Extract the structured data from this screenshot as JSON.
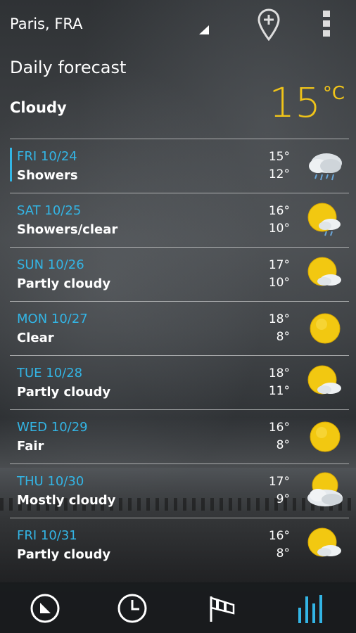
{
  "header": {
    "location": "Paris, FRA"
  },
  "title": "Daily forecast",
  "current": {
    "condition": "Cloudy",
    "temp": "15",
    "unit": "°C"
  },
  "days": [
    {
      "day": "FRI 10/24",
      "desc": "Showers",
      "hi": "15°",
      "lo": "12°",
      "icon": "rain-cloud-icon"
    },
    {
      "day": "SAT 10/25",
      "desc": "Showers/clear",
      "hi": "16°",
      "lo": "10°",
      "icon": "sun-rain-icon"
    },
    {
      "day": "SUN 10/26",
      "desc": "Partly cloudy",
      "hi": "17°",
      "lo": "10°",
      "icon": "partly-cloudy-icon"
    },
    {
      "day": "MON 10/27",
      "desc": "Clear",
      "hi": "18°",
      "lo": "8°",
      "icon": "sun-icon"
    },
    {
      "day": "TUE 10/28",
      "desc": "Partly cloudy",
      "hi": "18°",
      "lo": "11°",
      "icon": "partly-cloudy-icon"
    },
    {
      "day": "WED 10/29",
      "desc": "Fair",
      "hi": "16°",
      "lo": "8°",
      "icon": "sun-icon"
    },
    {
      "day": "THU 10/30",
      "desc": "Mostly cloudy",
      "hi": "17°",
      "lo": "9°",
      "icon": "mostly-cloudy-icon"
    },
    {
      "day": "FRI 10/31",
      "desc": "Partly cloudy",
      "hi": "16°",
      "lo": "8°",
      "icon": "partly-cloudy-icon"
    }
  ],
  "tabs": [
    "current-tab",
    "hourly-tab",
    "wind-tab",
    "daily-tab"
  ],
  "colors": {
    "accent": "#33b5e5",
    "temp": "#f0c419"
  }
}
